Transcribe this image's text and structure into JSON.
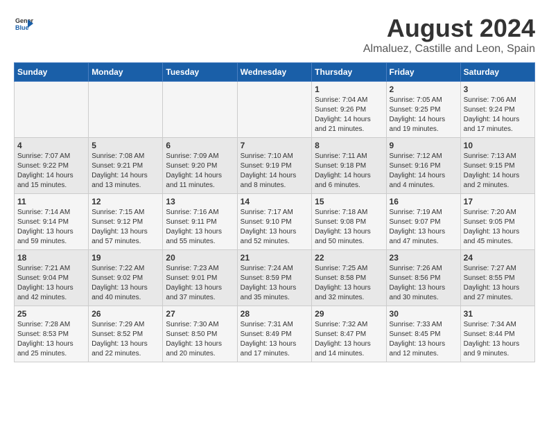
{
  "header": {
    "logo_line1": "General",
    "logo_line2": "Blue",
    "title": "August 2024",
    "subtitle": "Almaluez, Castille and Leon, Spain"
  },
  "weekdays": [
    "Sunday",
    "Monday",
    "Tuesday",
    "Wednesday",
    "Thursday",
    "Friday",
    "Saturday"
  ],
  "weeks": [
    [
      {
        "day": "",
        "info": ""
      },
      {
        "day": "",
        "info": ""
      },
      {
        "day": "",
        "info": ""
      },
      {
        "day": "",
        "info": ""
      },
      {
        "day": "1",
        "info": "Sunrise: 7:04 AM\nSunset: 9:26 PM\nDaylight: 14 hours\nand 21 minutes."
      },
      {
        "day": "2",
        "info": "Sunrise: 7:05 AM\nSunset: 9:25 PM\nDaylight: 14 hours\nand 19 minutes."
      },
      {
        "day": "3",
        "info": "Sunrise: 7:06 AM\nSunset: 9:24 PM\nDaylight: 14 hours\nand 17 minutes."
      }
    ],
    [
      {
        "day": "4",
        "info": "Sunrise: 7:07 AM\nSunset: 9:22 PM\nDaylight: 14 hours\nand 15 minutes."
      },
      {
        "day": "5",
        "info": "Sunrise: 7:08 AM\nSunset: 9:21 PM\nDaylight: 14 hours\nand 13 minutes."
      },
      {
        "day": "6",
        "info": "Sunrise: 7:09 AM\nSunset: 9:20 PM\nDaylight: 14 hours\nand 11 minutes."
      },
      {
        "day": "7",
        "info": "Sunrise: 7:10 AM\nSunset: 9:19 PM\nDaylight: 14 hours\nand 8 minutes."
      },
      {
        "day": "8",
        "info": "Sunrise: 7:11 AM\nSunset: 9:18 PM\nDaylight: 14 hours\nand 6 minutes."
      },
      {
        "day": "9",
        "info": "Sunrise: 7:12 AM\nSunset: 9:16 PM\nDaylight: 14 hours\nand 4 minutes."
      },
      {
        "day": "10",
        "info": "Sunrise: 7:13 AM\nSunset: 9:15 PM\nDaylight: 14 hours\nand 2 minutes."
      }
    ],
    [
      {
        "day": "11",
        "info": "Sunrise: 7:14 AM\nSunset: 9:14 PM\nDaylight: 13 hours\nand 59 minutes."
      },
      {
        "day": "12",
        "info": "Sunrise: 7:15 AM\nSunset: 9:12 PM\nDaylight: 13 hours\nand 57 minutes."
      },
      {
        "day": "13",
        "info": "Sunrise: 7:16 AM\nSunset: 9:11 PM\nDaylight: 13 hours\nand 55 minutes."
      },
      {
        "day": "14",
        "info": "Sunrise: 7:17 AM\nSunset: 9:10 PM\nDaylight: 13 hours\nand 52 minutes."
      },
      {
        "day": "15",
        "info": "Sunrise: 7:18 AM\nSunset: 9:08 PM\nDaylight: 13 hours\nand 50 minutes."
      },
      {
        "day": "16",
        "info": "Sunrise: 7:19 AM\nSunset: 9:07 PM\nDaylight: 13 hours\nand 47 minutes."
      },
      {
        "day": "17",
        "info": "Sunrise: 7:20 AM\nSunset: 9:05 PM\nDaylight: 13 hours\nand 45 minutes."
      }
    ],
    [
      {
        "day": "18",
        "info": "Sunrise: 7:21 AM\nSunset: 9:04 PM\nDaylight: 13 hours\nand 42 minutes."
      },
      {
        "day": "19",
        "info": "Sunrise: 7:22 AM\nSunset: 9:02 PM\nDaylight: 13 hours\nand 40 minutes."
      },
      {
        "day": "20",
        "info": "Sunrise: 7:23 AM\nSunset: 9:01 PM\nDaylight: 13 hours\nand 37 minutes."
      },
      {
        "day": "21",
        "info": "Sunrise: 7:24 AM\nSunset: 8:59 PM\nDaylight: 13 hours\nand 35 minutes."
      },
      {
        "day": "22",
        "info": "Sunrise: 7:25 AM\nSunset: 8:58 PM\nDaylight: 13 hours\nand 32 minutes."
      },
      {
        "day": "23",
        "info": "Sunrise: 7:26 AM\nSunset: 8:56 PM\nDaylight: 13 hours\nand 30 minutes."
      },
      {
        "day": "24",
        "info": "Sunrise: 7:27 AM\nSunset: 8:55 PM\nDaylight: 13 hours\nand 27 minutes."
      }
    ],
    [
      {
        "day": "25",
        "info": "Sunrise: 7:28 AM\nSunset: 8:53 PM\nDaylight: 13 hours\nand 25 minutes."
      },
      {
        "day": "26",
        "info": "Sunrise: 7:29 AM\nSunset: 8:52 PM\nDaylight: 13 hours\nand 22 minutes."
      },
      {
        "day": "27",
        "info": "Sunrise: 7:30 AM\nSunset: 8:50 PM\nDaylight: 13 hours\nand 20 minutes."
      },
      {
        "day": "28",
        "info": "Sunrise: 7:31 AM\nSunset: 8:49 PM\nDaylight: 13 hours\nand 17 minutes."
      },
      {
        "day": "29",
        "info": "Sunrise: 7:32 AM\nSunset: 8:47 PM\nDaylight: 13 hours\nand 14 minutes."
      },
      {
        "day": "30",
        "info": "Sunrise: 7:33 AM\nSunset: 8:45 PM\nDaylight: 13 hours\nand 12 minutes."
      },
      {
        "day": "31",
        "info": "Sunrise: 7:34 AM\nSunset: 8:44 PM\nDaylight: 13 hours\nand 9 minutes."
      }
    ]
  ]
}
